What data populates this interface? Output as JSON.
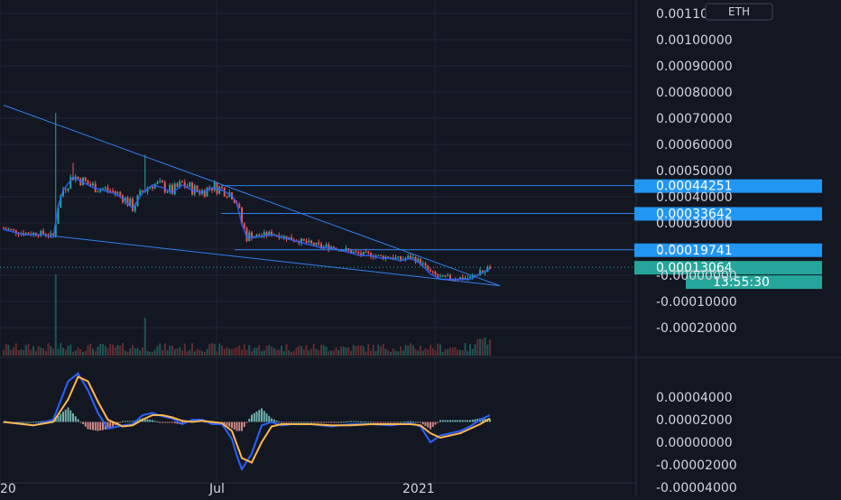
{
  "colors": {
    "background": "#131722",
    "grid": "#1f2433",
    "axis_text": "#d1d4dc",
    "trendline": "#2f80ed",
    "level_badge": "#2196f3",
    "last_price_badge": "#26a69a",
    "candle_up": "#26a69a",
    "candle_down": "#ef5350",
    "ema_fast": "#2962ff",
    "ema_slow": "#ffb74d",
    "volume": "#5d6473"
  },
  "chart_data": [
    {
      "type": "candlestick",
      "currency_label": "ETH",
      "x_axis_labels": [
        "20",
        "Jul",
        "2021"
      ],
      "y_ticks": [
        "0.00110000",
        "0.00100000",
        "0.00090000",
        "0.00080000",
        "0.00070000",
        "0.00060000",
        "0.00050000",
        "0.00040000",
        "0.00030000",
        "0.0",
        "-0.00000000",
        "-0.00010000",
        "-0.00020000"
      ],
      "ylim": [
        -0.0002,
        0.0011
      ],
      "price_path": [
        [
          0,
          0.00028
        ],
        [
          4,
          0.00026
        ],
        [
          8,
          0.00026
        ],
        [
          10,
          0.00025
        ],
        [
          11,
          0.00037
        ],
        [
          12,
          0.00043
        ],
        [
          14,
          0.00048
        ],
        [
          16,
          0.00046
        ],
        [
          18,
          0.00044
        ],
        [
          20,
          0.00043
        ],
        [
          22,
          0.00042
        ],
        [
          24,
          0.0004
        ],
        [
          26,
          0.00036
        ],
        [
          28,
          0.00042
        ],
        [
          30,
          0.00045
        ],
        [
          32,
          0.00044
        ],
        [
          34,
          0.00042
        ],
        [
          36,
          0.00045
        ],
        [
          38,
          0.00043
        ],
        [
          40,
          0.00042
        ],
        [
          42,
          0.00044
        ],
        [
          44,
          0.00043
        ],
        [
          46,
          0.00041
        ],
        [
          47,
          0.00038
        ],
        [
          48,
          0.0003
        ],
        [
          49,
          0.00025
        ],
        [
          51,
          0.00025
        ],
        [
          54,
          0.00026
        ],
        [
          56,
          0.00025
        ],
        [
          58,
          0.00024
        ],
        [
          60,
          0.00023
        ],
        [
          62,
          0.00022
        ],
        [
          64,
          0.00021
        ],
        [
          66,
          0.00021
        ],
        [
          68,
          0.0002
        ],
        [
          70,
          0.00019
        ],
        [
          72,
          0.00018
        ],
        [
          74,
          0.00018
        ],
        [
          76,
          0.00017
        ],
        [
          78,
          0.00017
        ],
        [
          80,
          0.00016
        ],
        [
          82,
          0.00017
        ],
        [
          84,
          0.00015
        ],
        [
          86,
          0.00011
        ],
        [
          88,
          9e-05
        ],
        [
          90,
          9e-05
        ],
        [
          92,
          9e-05
        ],
        [
          94,
          9e-05
        ],
        [
          95,
          0.0001
        ],
        [
          96,
          0.00011
        ],
        [
          97,
          0.00012
        ],
        [
          98,
          0.00013
        ]
      ],
      "horizontal_levels": [
        "0.00044251",
        "0.00033642",
        "0.00019741"
      ],
      "last_price": "0.00013064",
      "countdown": "13:55:30",
      "trendlines": [
        {
          "from": [
            0,
            0.00075
          ],
          "to": [
            100,
            6e-05
          ]
        },
        {
          "from": [
            10,
            0.00025
          ],
          "to": [
            100,
            6e-05
          ]
        }
      ]
    },
    {
      "type": "line",
      "panel": "oscillator",
      "y_ticks": [
        "0.00004000",
        "0.00002000",
        "0.00000000",
        "-0.00002000",
        "-0.00004000"
      ],
      "ylim": [
        -5e-05,
        5e-05
      ],
      "series": [
        {
          "points": [
            [
              0,
              0
            ],
            [
              6,
              -3e-06
            ],
            [
              10,
              2e-06
            ],
            [
              13,
              3.6e-05
            ],
            [
              15,
              4.3e-05
            ],
            [
              17,
              2.8e-05
            ],
            [
              19,
              8e-06
            ],
            [
              21,
              -6e-06
            ],
            [
              24,
              -3e-06
            ],
            [
              26,
              -2e-06
            ],
            [
              28,
              6e-06
            ],
            [
              30,
              8e-06
            ],
            [
              32,
              5e-06
            ],
            [
              34,
              3e-06
            ],
            [
              36,
              -2e-06
            ],
            [
              38,
              2e-06
            ],
            [
              40,
              2e-06
            ],
            [
              42,
              -2e-06
            ],
            [
              44,
              -2e-06
            ],
            [
              46,
              -1.5e-05
            ],
            [
              47,
              -3e-05
            ],
            [
              48,
              -4.2e-05
            ],
            [
              50,
              -2.8e-05
            ],
            [
              52,
              -3e-06
            ],
            [
              54,
              0
            ],
            [
              56,
              -3e-06
            ],
            [
              58,
              -2e-06
            ],
            [
              62,
              -2e-06
            ],
            [
              66,
              -4e-06
            ],
            [
              70,
              -2e-06
            ],
            [
              74,
              -2e-06
            ],
            [
              78,
              -3e-06
            ],
            [
              82,
              -1e-06
            ],
            [
              84,
              -4e-06
            ],
            [
              86,
              -1.8e-05
            ],
            [
              88,
              -1.2e-05
            ],
            [
              90,
              -1e-05
            ],
            [
              92,
              -8e-06
            ],
            [
              94,
              -4e-06
            ],
            [
              96,
              2e-06
            ],
            [
              98,
              6e-06
            ]
          ]
        },
        {
          "points": [
            [
              0,
              0
            ],
            [
              6,
              -3e-06
            ],
            [
              10,
              0
            ],
            [
              13,
              2e-05
            ],
            [
              15,
              4e-05
            ],
            [
              17,
              3.6e-05
            ],
            [
              19,
              1.8e-05
            ],
            [
              21,
              2e-06
            ],
            [
              24,
              -4e-06
            ],
            [
              26,
              -3e-06
            ],
            [
              28,
              2e-06
            ],
            [
              30,
              6e-06
            ],
            [
              32,
              6e-06
            ],
            [
              34,
              4e-06
            ],
            [
              36,
              1e-06
            ],
            [
              38,
              0
            ],
            [
              40,
              1e-06
            ],
            [
              42,
              0
            ],
            [
              44,
              -1e-06
            ],
            [
              46,
              -8e-06
            ],
            [
              47,
              -2e-05
            ],
            [
              48,
              -3.2e-05
            ],
            [
              50,
              -3.6e-05
            ],
            [
              52,
              -1.8e-05
            ],
            [
              54,
              -4e-06
            ],
            [
              56,
              -2e-06
            ],
            [
              58,
              -2e-06
            ],
            [
              62,
              -2e-06
            ],
            [
              66,
              -3e-06
            ],
            [
              70,
              -3e-06
            ],
            [
              74,
              -2e-06
            ],
            [
              78,
              -2e-06
            ],
            [
              82,
              -2e-06
            ],
            [
              84,
              -3e-06
            ],
            [
              86,
              -1e-05
            ],
            [
              88,
              -1.4e-05
            ],
            [
              90,
              -1.2e-05
            ],
            [
              92,
              -1e-05
            ],
            [
              94,
              -6e-06
            ],
            [
              96,
              -2e-06
            ],
            [
              98,
              3e-06
            ]
          ]
        }
      ]
    }
  ]
}
